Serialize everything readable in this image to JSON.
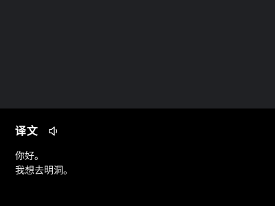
{
  "colors": {
    "top_background": "#202124",
    "panel_background": "#000000",
    "text": "#ffffff"
  },
  "translation": {
    "heading": "译文",
    "speaker_icon": "speaker-icon",
    "lines": [
      "你好。",
      "我想去明洞。"
    ]
  }
}
